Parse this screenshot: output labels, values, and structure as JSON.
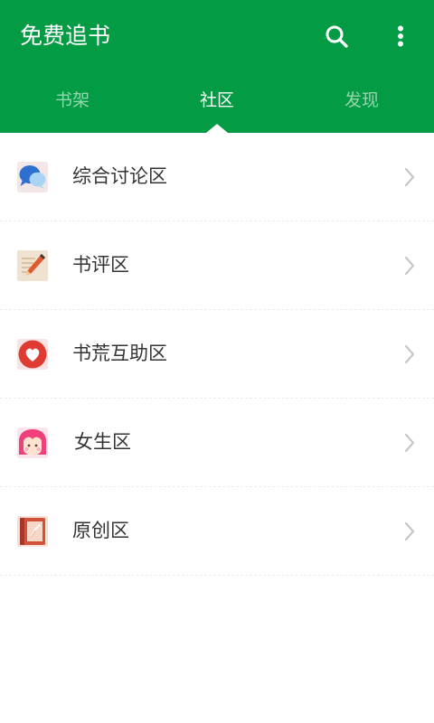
{
  "app": {
    "title": "免费追书"
  },
  "toolbar": {
    "search_icon": "search-icon",
    "more_icon": "more-vertical-icon"
  },
  "tabs": [
    {
      "label": "书架",
      "active": false
    },
    {
      "label": "社区",
      "active": true
    },
    {
      "label": "发现",
      "active": false
    }
  ],
  "community": {
    "items": [
      {
        "label": "综合讨论区",
        "icon": "chat-bubbles-icon"
      },
      {
        "label": "书评区",
        "icon": "notepad-pencil-icon"
      },
      {
        "label": "书荒互助区",
        "icon": "heart-icon"
      },
      {
        "label": "女生区",
        "icon": "girl-face-icon"
      },
      {
        "label": "原创区",
        "icon": "book-quill-icon"
      }
    ]
  },
  "colors": {
    "primary": "#039b43",
    "text": "#333333",
    "chevron": "#c7c7c7"
  }
}
